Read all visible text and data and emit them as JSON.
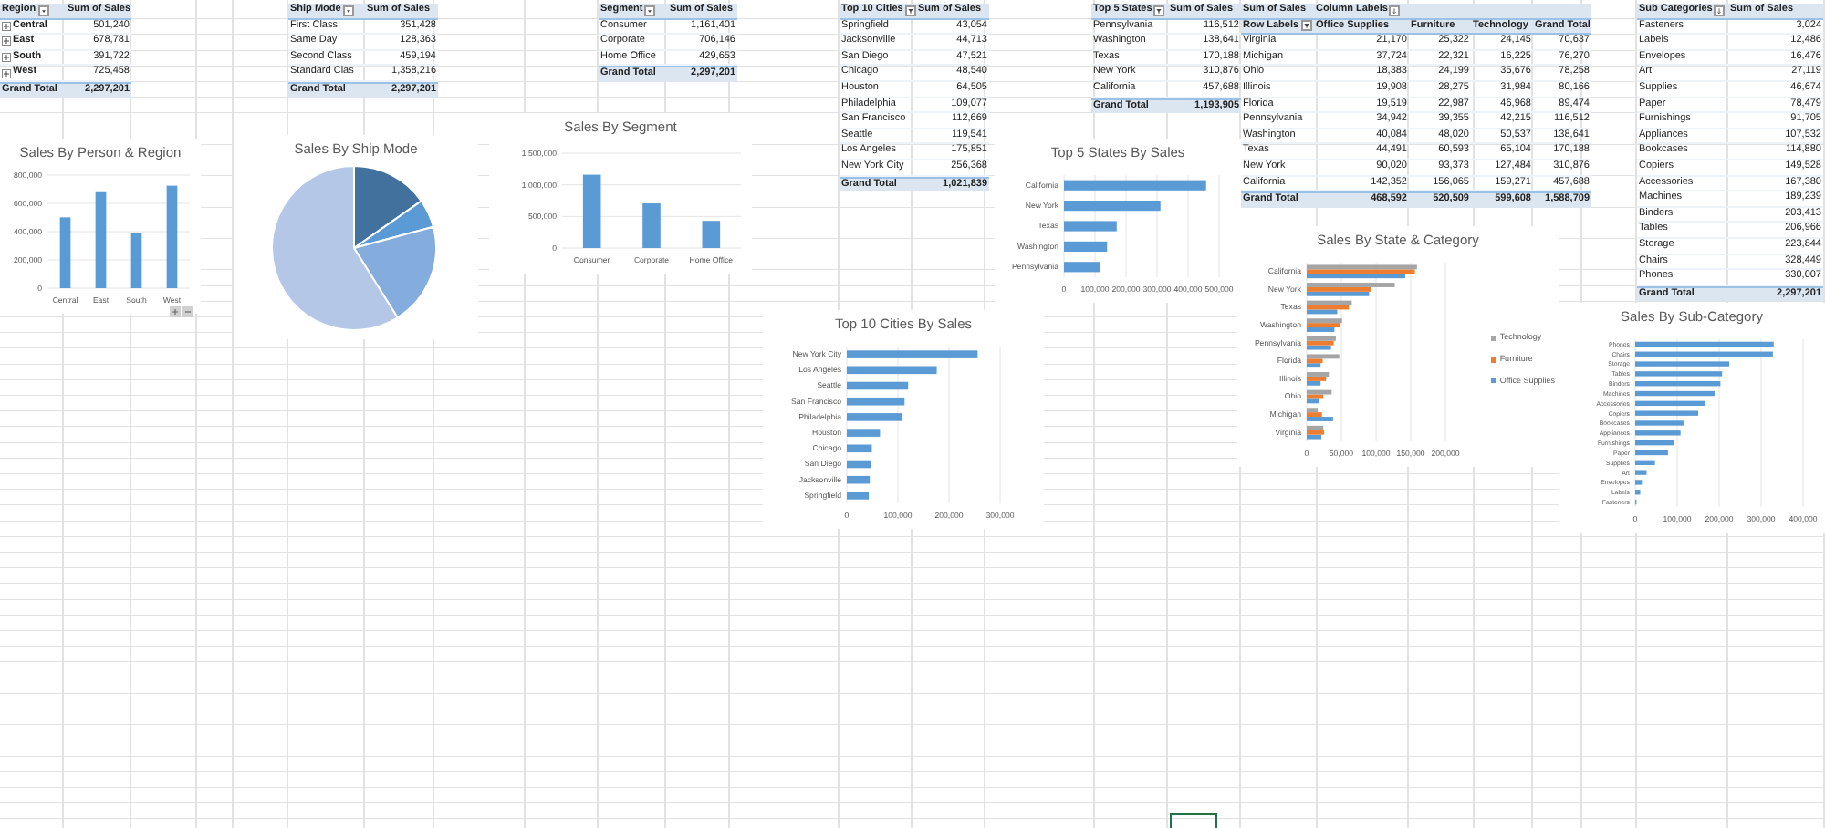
{
  "pivots": [
    {
      "header_rows": [
        [
          {
            "text": "Region",
            "dropdown": true,
            "filtered": false,
            "sorted": false
          },
          {
            "text": "Sum of Sales"
          }
        ]
      ],
      "rows": [
        {
          "label": "Central",
          "expandable": true,
          "values": [
            "501,240"
          ]
        },
        {
          "label": "East",
          "expandable": true,
          "values": [
            "678,781"
          ]
        },
        {
          "label": "South",
          "expandable": true,
          "values": [
            "391,722"
          ]
        },
        {
          "label": "West",
          "expandable": true,
          "values": [
            "725,458"
          ]
        }
      ],
      "total": {
        "label": "Grand Total",
        "values": [
          "2,297,201"
        ]
      }
    },
    {
      "header_rows": [
        [
          {
            "text": "Ship Mode",
            "dropdown": true,
            "filtered": false,
            "sorted": false
          },
          {
            "text": "Sum of Sales"
          }
        ]
      ],
      "rows": [
        {
          "label": "First Class",
          "values": [
            "351,428"
          ]
        },
        {
          "label": "Same Day",
          "values": [
            "128,363"
          ]
        },
        {
          "label": "Second Class",
          "values": [
            "459,194"
          ]
        },
        {
          "label": "Standard Clas",
          "values": [
            "1,358,216"
          ]
        }
      ],
      "total": {
        "label": "Grand Total",
        "values": [
          "2,297,201"
        ]
      }
    },
    {
      "header_rows": [
        [
          {
            "text": "Segment",
            "dropdown": true,
            "filtered": false,
            "sorted": false
          },
          {
            "text": "Sum of Sales"
          }
        ]
      ],
      "rows": [
        {
          "label": "Consumer",
          "values": [
            "1,161,401"
          ]
        },
        {
          "label": "Corporate",
          "values": [
            "706,146"
          ]
        },
        {
          "label": "Home Office",
          "values": [
            "429,653"
          ]
        }
      ],
      "total": {
        "label": "Grand Total",
        "values": [
          "2,297,201"
        ]
      }
    },
    {
      "header_rows": [
        [
          {
            "text": "Top 10 Cities",
            "dropdown": true,
            "filtered": true,
            "sorted": false
          },
          {
            "text": "Sum of Sales"
          }
        ]
      ],
      "rows": [
        {
          "label": "Springfield",
          "values": [
            "43,054"
          ]
        },
        {
          "label": "Jacksonville",
          "values": [
            "44,713"
          ]
        },
        {
          "label": "San Diego",
          "values": [
            "47,521"
          ]
        },
        {
          "label": "Chicago",
          "values": [
            "48,540"
          ]
        },
        {
          "label": "Houston",
          "values": [
            "64,505"
          ]
        },
        {
          "label": "Philadelphia",
          "values": [
            "109,077"
          ]
        },
        {
          "label": "San Francisco",
          "values": [
            "112,669"
          ]
        },
        {
          "label": "Seattle",
          "values": [
            "119,541"
          ]
        },
        {
          "label": "Los Angeles",
          "values": [
            "175,851"
          ]
        },
        {
          "label": "New York City",
          "values": [
            "256,368"
          ]
        }
      ],
      "total": {
        "label": "Grand Total",
        "values": [
          "1,021,839"
        ]
      }
    },
    {
      "header_rows": [
        [
          {
            "text": "Top 5 States",
            "dropdown": true,
            "filtered": true,
            "sorted": false
          },
          {
            "text": "Sum of Sales"
          }
        ]
      ],
      "rows": [
        {
          "label": "Pennsylvania",
          "values": [
            "116,512"
          ]
        },
        {
          "label": "Washington",
          "values": [
            "138,641"
          ]
        },
        {
          "label": "Texas",
          "values": [
            "170,188"
          ]
        },
        {
          "label": "New York",
          "values": [
            "310,876"
          ]
        },
        {
          "label": "California",
          "values": [
            "457,688"
          ]
        }
      ],
      "total": {
        "label": "Grand Total",
        "values": [
          "1,193,905"
        ]
      }
    },
    {
      "header_rows": [
        [
          {
            "text": "Sum of Sales"
          },
          {
            "text": "Column Labels",
            "dropdown": true,
            "filtered": false,
            "sorted": true
          }
        ],
        [
          {
            "text": "Row Labels",
            "dropdown": true,
            "filtered": true,
            "sorted": false
          },
          {
            "text": "Office Supplies"
          },
          {
            "text": "Furniture"
          },
          {
            "text": "Technology"
          },
          {
            "text": "Grand Total"
          }
        ]
      ],
      "rows": [
        {
          "label": "Virginia",
          "values": [
            "21,170",
            "25,322",
            "24,145",
            "70,637"
          ]
        },
        {
          "label": "Michigan",
          "values": [
            "37,724",
            "22,321",
            "16,225",
            "76,270"
          ]
        },
        {
          "label": "Ohio",
          "values": [
            "18,383",
            "24,199",
            "35,676",
            "78,258"
          ]
        },
        {
          "label": "Illinois",
          "values": [
            "19,908",
            "28,275",
            "31,984",
            "80,166"
          ]
        },
        {
          "label": "Florida",
          "values": [
            "19,519",
            "22,987",
            "46,968",
            "89,474"
          ]
        },
        {
          "label": "Pennsylvania",
          "values": [
            "34,942",
            "39,355",
            "42,215",
            "116,512"
          ]
        },
        {
          "label": "Washington",
          "values": [
            "40,084",
            "48,020",
            "50,537",
            "138,641"
          ]
        },
        {
          "label": "Texas",
          "values": [
            "44,491",
            "60,593",
            "65,104",
            "170,188"
          ]
        },
        {
          "label": "New York",
          "values": [
            "90,020",
            "93,373",
            "127,484",
            "310,876"
          ]
        },
        {
          "label": "California",
          "values": [
            "142,352",
            "156,065",
            "159,271",
            "457,688"
          ]
        }
      ],
      "total": {
        "label": "Grand Total",
        "values": [
          "468,592",
          "520,509",
          "599,608",
          "1,588,709"
        ]
      }
    },
    {
      "header_rows": [
        [
          {
            "text": "Sub Categories",
            "dropdown": true,
            "filtered": false,
            "sorted": true
          },
          {
            "text": "Sum of Sales"
          }
        ]
      ],
      "rows": [
        {
          "label": "Fasteners",
          "values": [
            "3,024"
          ]
        },
        {
          "label": "Labels",
          "values": [
            "12,486"
          ]
        },
        {
          "label": "Envelopes",
          "values": [
            "16,476"
          ]
        },
        {
          "label": "Art",
          "values": [
            "27,119"
          ]
        },
        {
          "label": "Supplies",
          "values": [
            "46,674"
          ]
        },
        {
          "label": "Paper",
          "values": [
            "78,479"
          ]
        },
        {
          "label": "Furnishings",
          "values": [
            "91,705"
          ]
        },
        {
          "label": "Appliances",
          "values": [
            "107,532"
          ]
        },
        {
          "label": "Bookcases",
          "values": [
            "114,880"
          ]
        },
        {
          "label": "Copiers",
          "values": [
            "149,528"
          ]
        },
        {
          "label": "Accessories",
          "values": [
            "167,380"
          ]
        },
        {
          "label": "Machines",
          "values": [
            "189,239"
          ]
        },
        {
          "label": "Binders",
          "values": [
            "203,413"
          ]
        },
        {
          "label": "Tables",
          "values": [
            "206,966"
          ]
        },
        {
          "label": "Storage",
          "values": [
            "223,844"
          ]
        },
        {
          "label": "Chairs",
          "values": [
            "328,449"
          ]
        },
        {
          "label": "Phones",
          "values": [
            "330,007"
          ]
        }
      ],
      "total": {
        "label": "Grand Total",
        "values": [
          "2,297,201"
        ]
      }
    }
  ],
  "charts": [
    {
      "drill_buttons": true,
      "chart_data": {
        "type": "bar",
        "orientation": "vertical",
        "title": "Sales By Person & Region",
        "grid": true,
        "categories": [
          "Central",
          "East",
          "South",
          "West"
        ],
        "values": [
          501000,
          679000,
          392000,
          725000
        ],
        "ylim": [
          0,
          800000
        ],
        "yticks": [
          {
            "value": 0,
            "label": "0"
          },
          {
            "value": 200000,
            "label": "200,000"
          },
          {
            "value": 400000,
            "label": "400,000"
          },
          {
            "value": 600000,
            "label": "600,000"
          },
          {
            "value": 800000,
            "label": "800,000"
          }
        ]
      }
    },
    {
      "kind": "picture",
      "title": "Sales By Ship Mode"
    },
    {
      "chart_data": {
        "type": "bar",
        "orientation": "vertical",
        "title": "Sales By Segment",
        "grid": true,
        "categories": [
          "Consumer",
          "Corporate",
          "Home Office"
        ],
        "values": [
          1160000,
          706000,
          430000
        ],
        "ylim": [
          0,
          1500000
        ],
        "yticks": [
          {
            "value": 0,
            "label": "0"
          },
          {
            "value": 500000,
            "label": "500,000"
          },
          {
            "value": 1000000,
            "label": "1,000,000"
          },
          {
            "value": 1500000,
            "label": "1,500,000"
          }
        ]
      }
    },
    {
      "chart_data": {
        "type": "bar",
        "orientation": "horizontal",
        "title": "Top 5 States By Sales",
        "grid": true,
        "categories": [
          "California",
          "New York",
          "Texas",
          "Washington",
          "Pennsylvania"
        ],
        "values": [
          458000,
          311000,
          170000,
          139000,
          117000
        ],
        "xlim": [
          0,
          500000
        ],
        "xticks": [
          {
            "value": 0,
            "label": "0"
          },
          {
            "value": 100000,
            "label": "100,000"
          },
          {
            "value": 200000,
            "label": "200,000"
          },
          {
            "value": 300000,
            "label": "300,000"
          },
          {
            "value": 400000,
            "label": "400,000"
          },
          {
            "value": 500000,
            "label": "500,000"
          }
        ]
      }
    },
    {
      "chart_data": {
        "type": "bar",
        "orientation": "horizontal",
        "title": "Top 10 Cities By Sales",
        "grid": true,
        "categories": [
          "New York City",
          "Los Angeles",
          "Seattle",
          "San Francisco",
          "Philadelphia",
          "Houston",
          "Chicago",
          "San Diego",
          "Jacksonville",
          "Springfield"
        ],
        "values": [
          256000,
          176000,
          120000,
          113000,
          109000,
          65000,
          49000,
          48000,
          45000,
          43000
        ],
        "xlim": [
          0,
          300000
        ],
        "xticks": [
          {
            "value": 0,
            "label": "0"
          },
          {
            "value": 100000,
            "label": "100,000"
          },
          {
            "value": 200000,
            "label": "200,000"
          },
          {
            "value": 300000,
            "label": "300,000"
          }
        ]
      }
    },
    {
      "chart_data": {
        "type": "bar",
        "orientation": "horizontal",
        "title": "Sales By State & Category",
        "grid": true,
        "legend": true,
        "categories": [
          "California",
          "New York",
          "Texas",
          "Washington",
          "Pennsylvania",
          "Florida",
          "Illinois",
          "Ohio",
          "Michigan",
          "Virginia"
        ],
        "series": [
          {
            "name": "Office Supplies",
            "color": "#5b9bd5",
            "values": [
              142000,
              90000,
              44000,
              40000,
              35000,
              20000,
              20000,
              18000,
              38000,
              21000
            ]
          },
          {
            "name": "Furniture",
            "color": "#ed7d31",
            "values": [
              156000,
              93000,
              61000,
              48000,
              39000,
              23000,
              28000,
              24000,
              22000,
              25000
            ]
          },
          {
            "name": "Technology",
            "color": "#a5a5a5",
            "values": [
              159000,
              127000,
              65000,
              51000,
              42000,
              47000,
              32000,
              36000,
              16000,
              24000
            ]
          }
        ],
        "xlim": [
          0,
          200000
        ],
        "xticks": [
          {
            "value": 0,
            "label": "0"
          },
          {
            "value": 50000,
            "label": "50,000"
          },
          {
            "value": 100000,
            "label": "100,000"
          },
          {
            "value": 150000,
            "label": "150,000"
          },
          {
            "value": 200000,
            "label": "200,000"
          }
        ]
      }
    },
    {
      "chart_data": {
        "type": "bar",
        "orientation": "horizontal",
        "title": "Sales By Sub-Category",
        "grid": true,
        "categories": [
          "Phones",
          "Chairs",
          "Storage",
          "Tables",
          "Binders",
          "Machines",
          "Accessories",
          "Copiers",
          "Bookcases",
          "Appliances",
          "Furnishings",
          "Paper",
          "Supplies",
          "Art",
          "Envelopes",
          "Labels",
          "Fasteners"
        ],
        "values": [
          330000,
          328000,
          224000,
          207000,
          203000,
          189000,
          167000,
          150000,
          115000,
          108000,
          92000,
          78000,
          47000,
          27000,
          16000,
          12000,
          3000
        ],
        "xlim": [
          0,
          400000
        ],
        "xticks": [
          {
            "value": 0,
            "label": "0"
          },
          {
            "value": 100000,
            "label": "100,000"
          },
          {
            "value": 200000,
            "label": "200,000"
          },
          {
            "value": 300000,
            "label": "300,000"
          },
          {
            "value": 400000,
            "label": "400,000"
          }
        ]
      }
    }
  ]
}
